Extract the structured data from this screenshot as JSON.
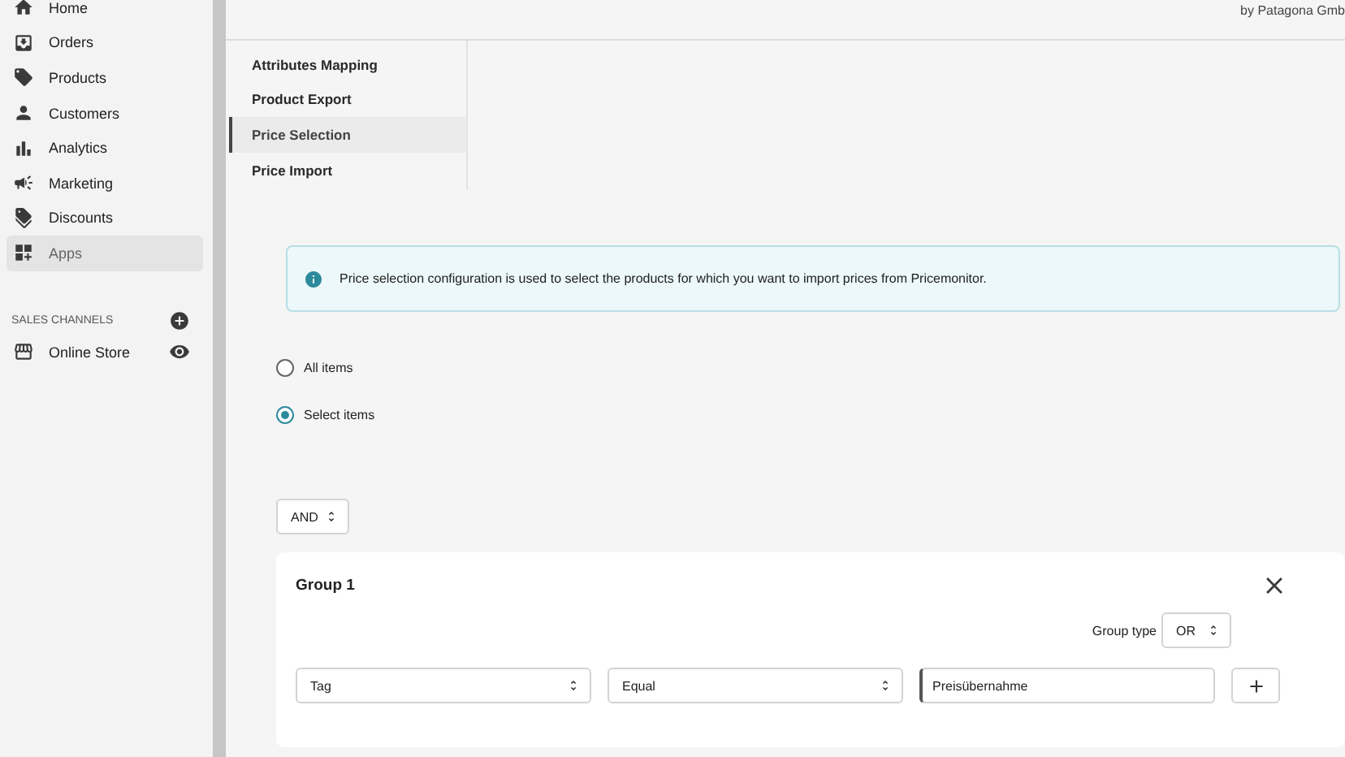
{
  "sidebar": {
    "items": [
      {
        "label": "Home",
        "selected": false
      },
      {
        "label": "Orders",
        "selected": false
      },
      {
        "label": "Products",
        "selected": false
      },
      {
        "label": "Customers",
        "selected": false
      },
      {
        "label": "Analytics",
        "selected": false
      },
      {
        "label": "Marketing",
        "selected": false
      },
      {
        "label": "Discounts",
        "selected": false
      },
      {
        "label": "Apps",
        "selected": true
      }
    ],
    "section_title": "SALES CHANNELS",
    "channels": [
      {
        "label": "Online Store"
      }
    ]
  },
  "header": {
    "vendor": "by Patagona Gmb"
  },
  "subnav": [
    {
      "label": "Attributes Mapping",
      "selected": false
    },
    {
      "label": "Product Export",
      "selected": false
    },
    {
      "label": "Price Selection",
      "selected": true
    },
    {
      "label": "Price Import",
      "selected": false
    }
  ],
  "banner": {
    "text": "Price selection configuration is used to select the products for which you want to import prices from Pricemonitor."
  },
  "options": [
    {
      "label": "All items",
      "selected": false
    },
    {
      "label": "Select items",
      "selected": true
    }
  ],
  "operator": {
    "value": "AND"
  },
  "group": {
    "title": "Group 1",
    "type_label": "Group type",
    "type_value": "OR",
    "condition": {
      "field": "Tag",
      "comparison": "Equal",
      "value": "Preisübernahme"
    }
  }
}
